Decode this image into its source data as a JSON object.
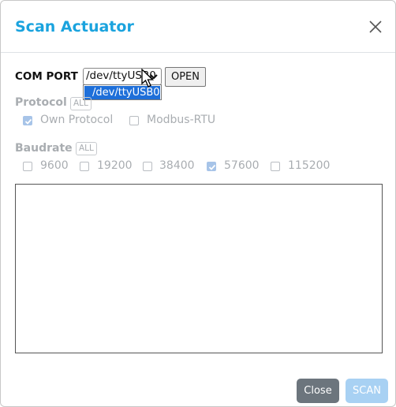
{
  "dialog": {
    "title": "Scan Actuator",
    "close_icon": "close-icon"
  },
  "comport": {
    "label": "COM PORT",
    "selected": "/dev/ttyUSB0",
    "options": [
      "/dev/ttyUSB0"
    ],
    "open_label": "OPEN"
  },
  "protocol": {
    "label": "Protocol",
    "all_label": "ALL",
    "options": [
      {
        "label": "Own Protocol",
        "checked": true
      },
      {
        "label": "Modbus-RTU",
        "checked": false
      }
    ]
  },
  "baudrate": {
    "label": "Baudrate",
    "all_label": "ALL",
    "options": [
      {
        "label": "9600",
        "checked": false
      },
      {
        "label": "19200",
        "checked": false
      },
      {
        "label": "38400",
        "checked": false
      },
      {
        "label": "57600",
        "checked": true
      },
      {
        "label": "115200",
        "checked": false
      }
    ]
  },
  "log": {
    "value": ""
  },
  "footer": {
    "close_label": "Close",
    "scan_label": "SCAN"
  },
  "colors": {
    "title": "#1aa3de",
    "close_button": "#6c757d",
    "scan_button": "#a8d1f3",
    "dropdown_highlight": "#1e6fd9"
  }
}
